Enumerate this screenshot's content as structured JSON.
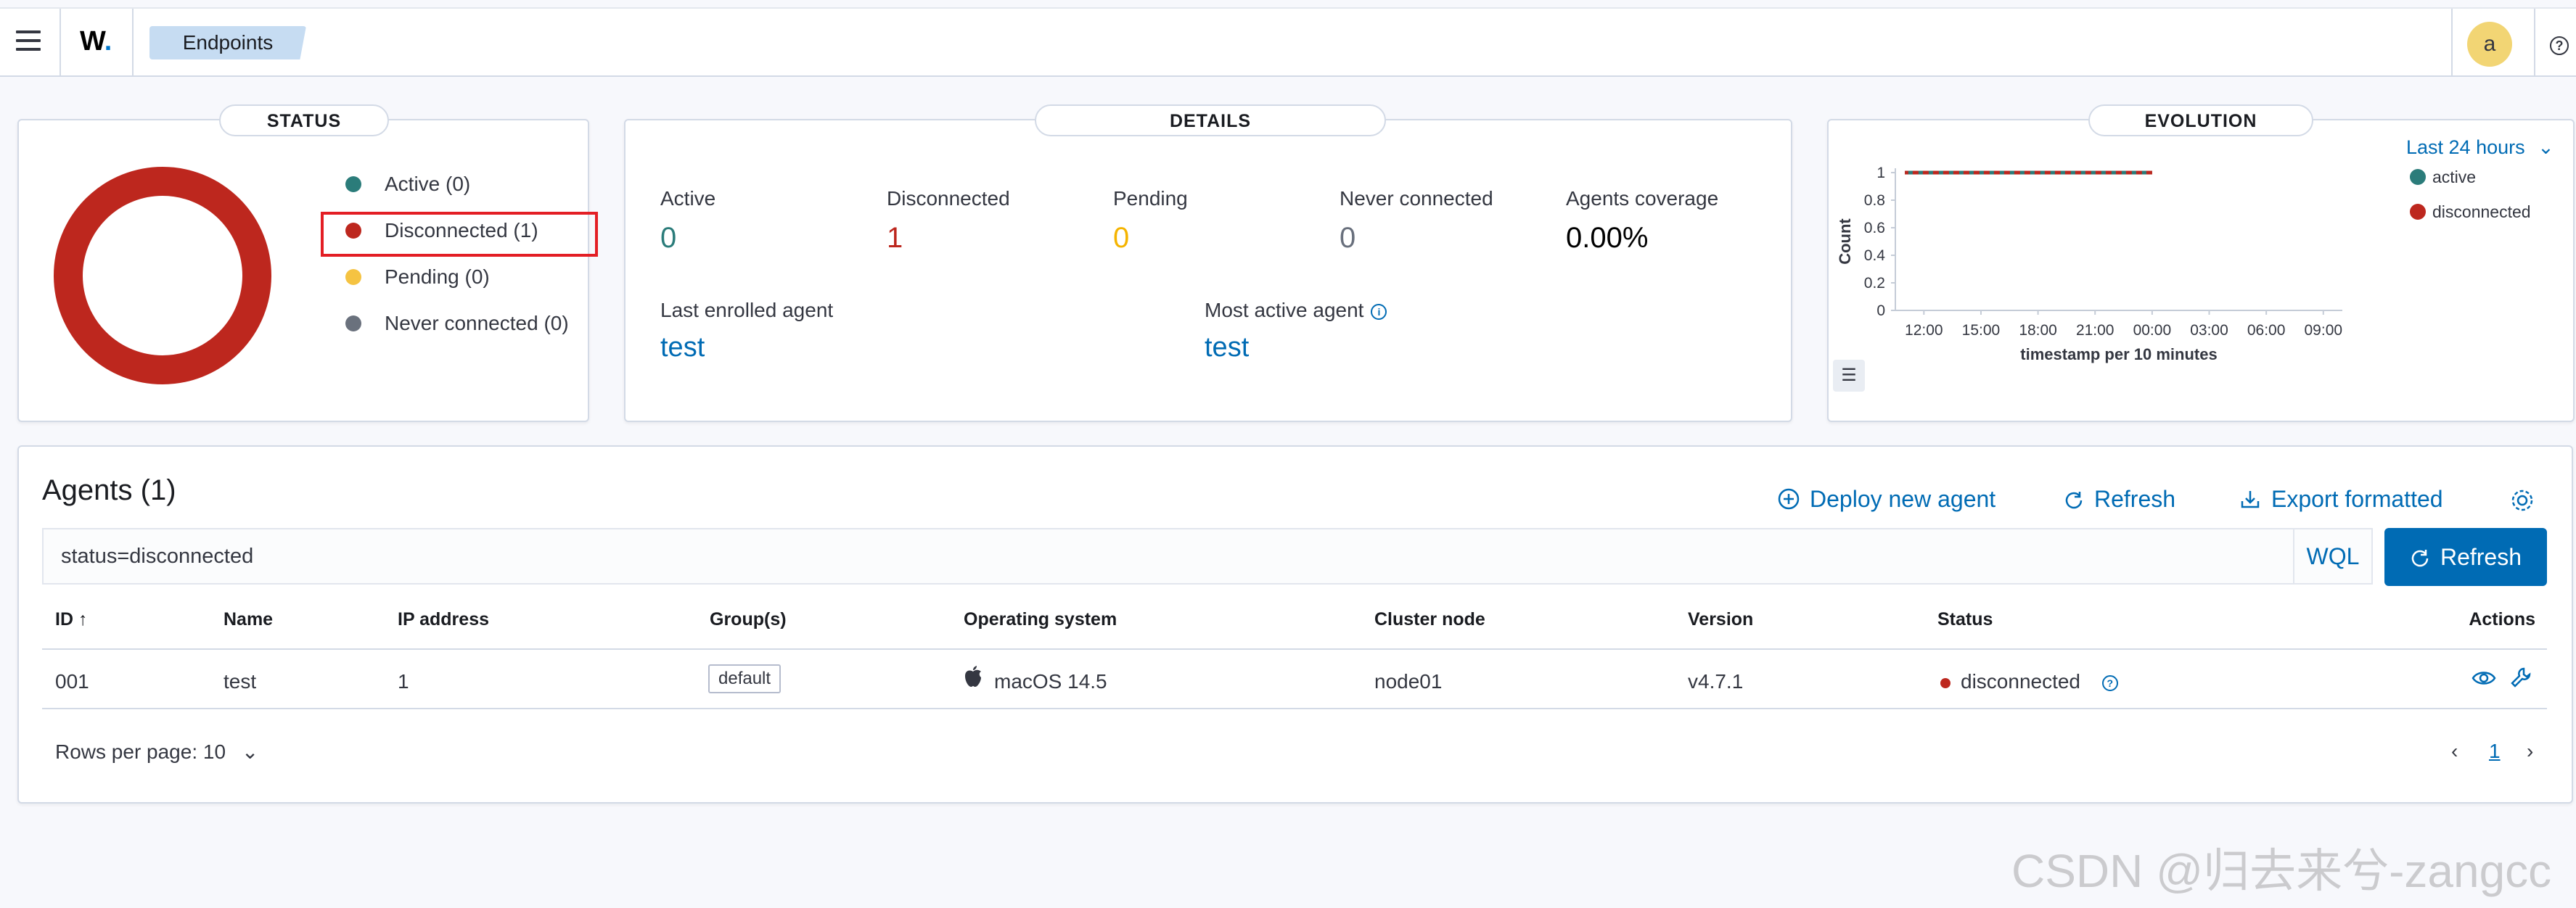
{
  "header": {
    "logo": "W",
    "logo_dot": ".",
    "breadcrumb": "Endpoints",
    "avatar": "a",
    "help": "?"
  },
  "status_panel": {
    "title": "STATUS",
    "legend": [
      {
        "label": "Active (0)",
        "color": "#2b7c7a"
      },
      {
        "label": "Disconnected (1)",
        "color": "#bd271e"
      },
      {
        "label": "Pending (0)",
        "color": "#f5c342"
      },
      {
        "label": "Never connected (0)",
        "color": "#6a717d"
      }
    ]
  },
  "details_panel": {
    "title": "DETAILS",
    "stats": [
      {
        "label": "Active",
        "value": "0",
        "color": "#2b7c7a"
      },
      {
        "label": "Disconnected",
        "value": "1",
        "color": "#bd271e"
      },
      {
        "label": "Pending",
        "value": "0",
        "color": "#f5b400"
      },
      {
        "label": "Never connected",
        "value": "0",
        "color": "#69707d"
      },
      {
        "label": "Agents coverage",
        "value": "0.00%",
        "color": "#000000"
      }
    ],
    "last_enrolled_label": "Last enrolled agent",
    "last_enrolled_value": "test",
    "most_active_label": "Most active agent",
    "most_active_value": "test",
    "info_icon": "i"
  },
  "evolution_panel": {
    "title": "EVOLUTION",
    "range": "Last 24 hours",
    "chevron": "⌄",
    "legend_icon": "☰",
    "chart_data": {
      "type": "line",
      "xlabel": "timestamp per 10 minutes",
      "ylabel": "Count",
      "x_ticks": [
        "12:00",
        "15:00",
        "18:00",
        "21:00",
        "00:00",
        "03:00",
        "06:00",
        "09:00"
      ],
      "y_ticks": [
        "0",
        "0.2",
        "0.4",
        "0.6",
        "0.8",
        "1"
      ],
      "ylim": [
        0,
        1
      ],
      "series": [
        {
          "name": "active",
          "color": "#2b7c7a",
          "x": [
            "00:00",
            "11:00"
          ],
          "values": [
            1,
            1
          ]
        },
        {
          "name": "disconnected",
          "color": "#bd271e",
          "x": [
            "00:00",
            "11:00"
          ],
          "values": [
            1,
            1
          ]
        }
      ]
    }
  },
  "agents": {
    "title": "Agents (1)",
    "deploy_label": "Deploy new agent",
    "refresh_link_label": "Refresh",
    "export_label": "Export formatted",
    "search_value": "status=disconnected",
    "wql_label": "WQL",
    "refresh_button_label": "Refresh",
    "columns": [
      "ID ↑",
      "Name",
      "IP address",
      "Group(s)",
      "Operating system",
      "Cluster node",
      "Version",
      "Status",
      "Actions"
    ],
    "rows": [
      {
        "id": "001",
        "name": "test",
        "ip": "1",
        "group": "default",
        "os": "macOS 14.5",
        "node": "node01",
        "version": "v4.7.1",
        "status": "disconnected",
        "status_color": "#bd271e"
      }
    ],
    "rows_per_page": "Rows per page: 10",
    "page": "1"
  },
  "watermark": "CSDN @归去来兮-zangcc"
}
